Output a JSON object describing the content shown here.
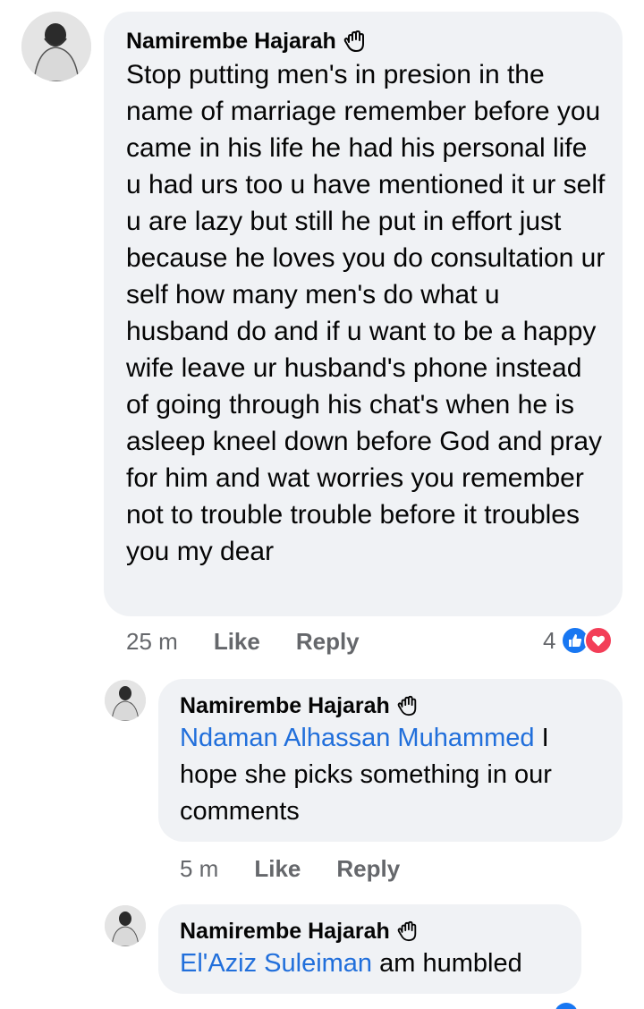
{
  "comments": [
    {
      "author": "Namirembe Hajarah",
      "text": "Stop putting men's in presion in the name of marriage remember before you came in his life he had his personal life u had urs too u have mentioned it ur self u are lazy but still he put in effort just because he loves you do consultation ur self how many men's do what u husband do and if u want to be a happy wife leave ur husband's phone instead of going through his chat's when he is asleep kneel down before God and pray for him and wat worries you remember not to trouble trouble before it troubles you my dear",
      "time": "25 m",
      "like_label": "Like",
      "reply_label": "Reply",
      "reaction_count": "4",
      "reaction_icons": [
        "like-icon",
        "love-icon"
      ]
    }
  ],
  "replies": [
    {
      "author": "Namirembe Hajarah",
      "mention": "Ndaman Alhassan Muhammed",
      "text": " I hope she picks something in our comments",
      "time": "5 m",
      "like_label": "Like",
      "reply_label": "Reply"
    },
    {
      "author": "Namirembe Hajarah",
      "mention": "El'Aziz Suleiman",
      "text": " am humbled"
    }
  ],
  "colors": {
    "bubble": "#f0f2f5",
    "mention": "#216fdb",
    "meta": "#65676b",
    "like": "#1877f2",
    "love": "#f33e58"
  }
}
